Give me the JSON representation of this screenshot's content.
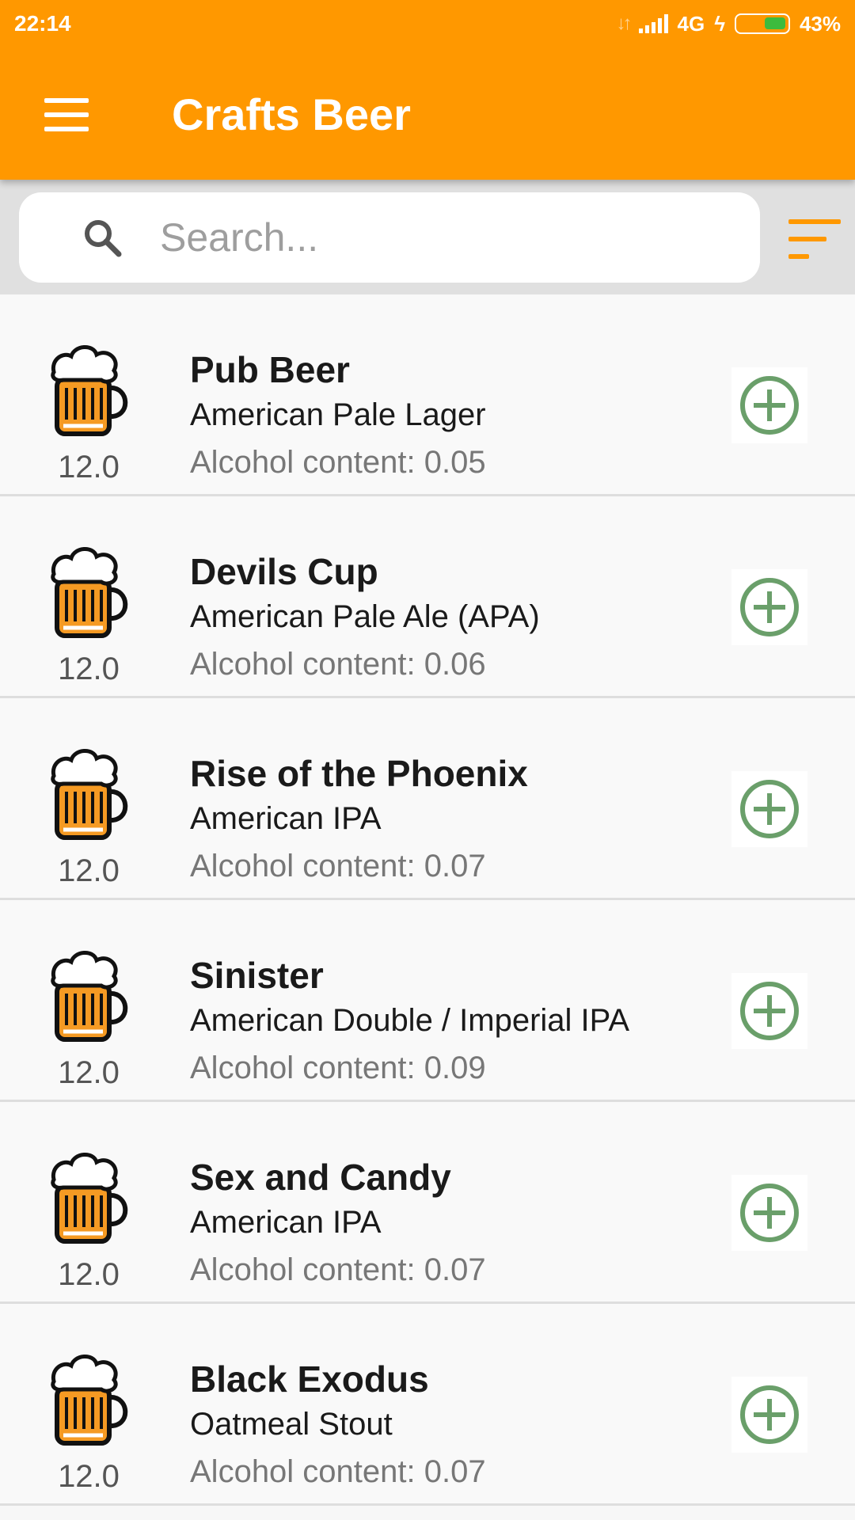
{
  "status_bar": {
    "time": "22:14",
    "network": "4G",
    "battery": "43%"
  },
  "app_bar": {
    "title": "Crafts Beer"
  },
  "search": {
    "placeholder": "Search..."
  },
  "colors": {
    "accent": "#ff9800",
    "add_icon": "#6a9f6a",
    "beer_body": "#f59a23"
  },
  "beers": [
    {
      "abv": "12.0",
      "name": "Pub Beer",
      "style": "American Pale Lager",
      "alcohol": "Alcohol content: 0.05"
    },
    {
      "abv": "12.0",
      "name": "Devils Cup",
      "style": "American Pale Ale (APA)",
      "alcohol": "Alcohol content: 0.06"
    },
    {
      "abv": "12.0",
      "name": "Rise of the Phoenix",
      "style": "American IPA",
      "alcohol": "Alcohol content: 0.07"
    },
    {
      "abv": "12.0",
      "name": "Sinister",
      "style": "American Double / Imperial IPA",
      "alcohol": "Alcohol content: 0.09"
    },
    {
      "abv": "12.0",
      "name": "Sex and Candy",
      "style": "American IPA",
      "alcohol": "Alcohol content: 0.07"
    },
    {
      "abv": "12.0",
      "name": "Black Exodus",
      "style": "Oatmeal Stout",
      "alcohol": "Alcohol content: 0.07"
    }
  ]
}
